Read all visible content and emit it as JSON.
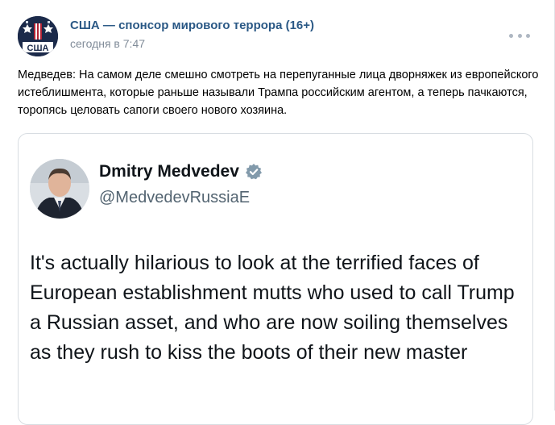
{
  "post": {
    "group_name": "США — спонсор мирового террора (16+)",
    "time": "сегодня в 7:47",
    "avatar_caption": "США",
    "text": "Медведев: На самом деле смешно смотреть на перепуганные лица дворняжек из европейского истеблишмента, которые раньше называли Трампа российским агентом, а теперь пачкаются, торопясь целовать сапоги своего нового хозяина."
  },
  "tweet": {
    "name": "Dmitry Medvedev",
    "handle": "@MedvedevRussiaE",
    "text": "It's actually hilarious to look at the terrified faces of European establishment mutts who used to call Trump a Russian asset, and who are now soiling themselves as they rush to kiss the boots of their new master"
  },
  "icons": {
    "more": "more-dots-icon",
    "verified": "verified-badge-icon"
  },
  "colors": {
    "link": "#2a5885",
    "muted": "#818c99",
    "tweet_text": "#0f1419",
    "verified": "#829aab"
  }
}
